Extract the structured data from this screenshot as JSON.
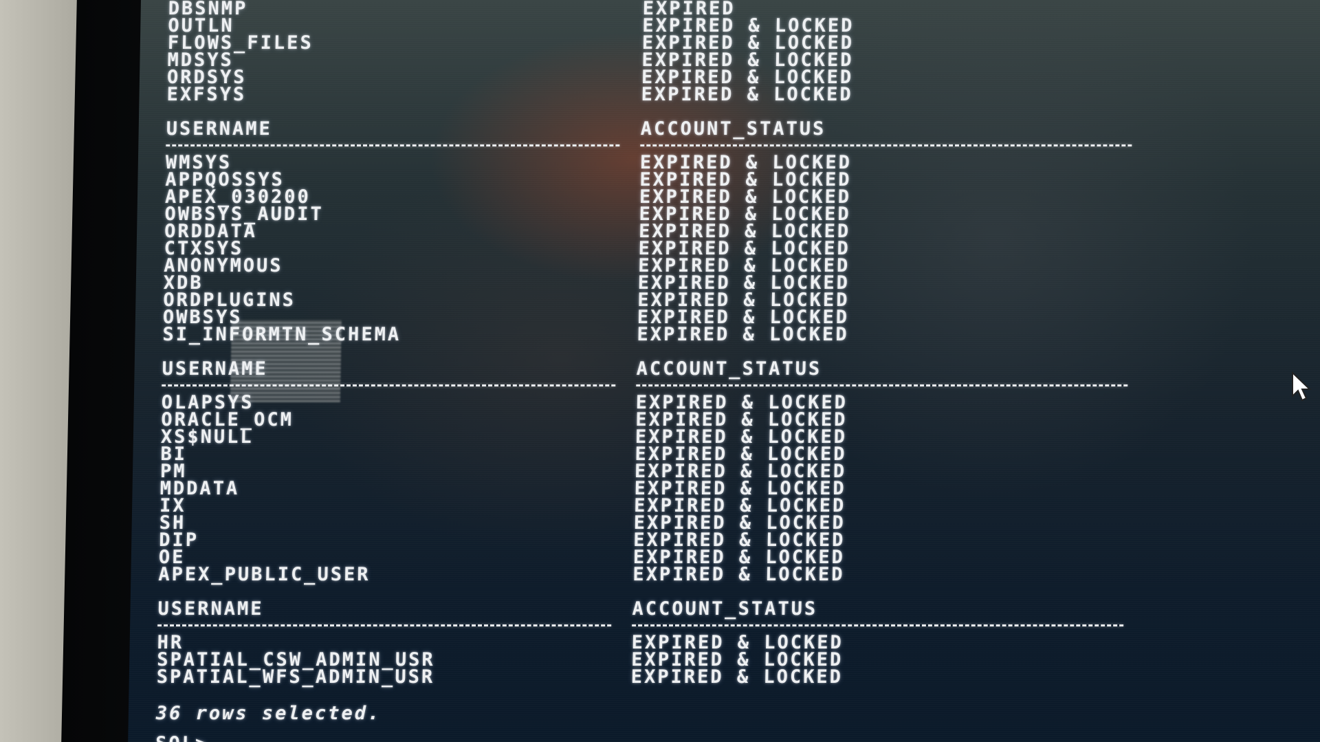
{
  "terminal": {
    "top_rows": [
      {
        "username": "DBSNMP",
        "status": "EXPIRED"
      },
      {
        "username": "OUTLN",
        "status": "EXPIRED & LOCKED"
      },
      {
        "username": "FLOWS_FILES",
        "status": "EXPIRED & LOCKED"
      },
      {
        "username": "MDSYS",
        "status": "EXPIRED & LOCKED"
      },
      {
        "username": "ORDSYS",
        "status": "EXPIRED & LOCKED"
      },
      {
        "username": "EXFSYS",
        "status": "EXPIRED & LOCKED"
      }
    ],
    "blocks": [
      {
        "header_user": "USERNAME",
        "header_status": "ACCOUNT_STATUS",
        "rows": [
          {
            "username": "WMSYS",
            "status": "EXPIRED & LOCKED"
          },
          {
            "username": "APPQOSSYS",
            "status": "EXPIRED & LOCKED"
          },
          {
            "username": "APEX_030200",
            "status": "EXPIRED & LOCKED"
          },
          {
            "username": "OWBSYS_AUDIT",
            "status": "EXPIRED & LOCKED"
          },
          {
            "username": "ORDDATA",
            "status": "EXPIRED & LOCKED"
          },
          {
            "username": "CTXSYS",
            "status": "EXPIRED & LOCKED"
          },
          {
            "username": "ANONYMOUS",
            "status": "EXPIRED & LOCKED"
          },
          {
            "username": "XDB",
            "status": "EXPIRED & LOCKED"
          },
          {
            "username": "ORDPLUGINS",
            "status": "EXPIRED & LOCKED"
          },
          {
            "username": "OWBSYS",
            "status": "EXPIRED & LOCKED"
          },
          {
            "username": "SI_INFORMTN_SCHEMA",
            "status": "EXPIRED & LOCKED"
          }
        ]
      },
      {
        "header_user": "USERNAME",
        "header_status": "ACCOUNT_STATUS",
        "rows": [
          {
            "username": "OLAPSYS",
            "status": "EXPIRED & LOCKED"
          },
          {
            "username": "ORACLE_OCM",
            "status": "EXPIRED & LOCKED"
          },
          {
            "username": "XS$NULL",
            "status": "EXPIRED & LOCKED"
          },
          {
            "username": "BI",
            "status": "EXPIRED & LOCKED"
          },
          {
            "username": "PM",
            "status": "EXPIRED & LOCKED"
          },
          {
            "username": "MDDATA",
            "status": "EXPIRED & LOCKED"
          },
          {
            "username": "IX",
            "status": "EXPIRED & LOCKED"
          },
          {
            "username": "SH",
            "status": "EXPIRED & LOCKED"
          },
          {
            "username": "DIP",
            "status": "EXPIRED & LOCKED"
          },
          {
            "username": "OE",
            "status": "EXPIRED & LOCKED"
          },
          {
            "username": "APEX_PUBLIC_USER",
            "status": "EXPIRED & LOCKED"
          }
        ]
      },
      {
        "header_user": "USERNAME",
        "header_status": "ACCOUNT_STATUS",
        "rows": [
          {
            "username": "HR",
            "status": "EXPIRED & LOCKED"
          },
          {
            "username": "SPATIAL_CSW_ADMIN_USR",
            "status": "EXPIRED & LOCKED"
          },
          {
            "username": "SPATIAL_WFS_ADMIN_USR",
            "status": "EXPIRED & LOCKED"
          }
        ]
      }
    ],
    "summary": "36 rows selected.",
    "prompt": "SQL>"
  },
  "colors": {
    "text": "#eef0f2",
    "screen_bg": "#0e1c2b"
  },
  "icons": {
    "pointer": "mouse-pointer-icon"
  }
}
